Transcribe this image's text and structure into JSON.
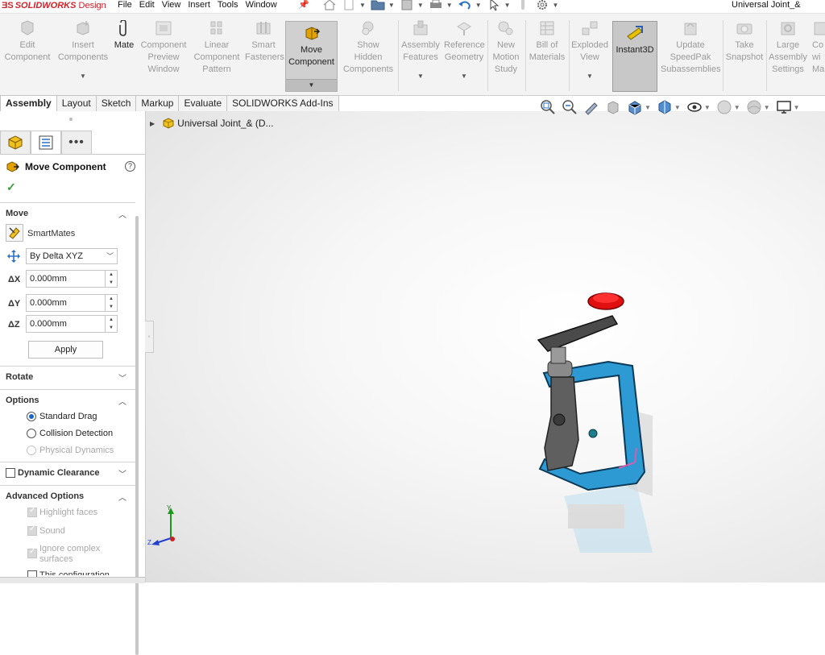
{
  "titlebar": {
    "logo_brand": "SOLIDWORKS",
    "logo_product": "Design",
    "menus": [
      "File",
      "Edit",
      "View",
      "Insert",
      "Tools",
      "Window"
    ],
    "document_title": "Universal Joint_&"
  },
  "command_manager": {
    "edit_component": "Edit\nComponent",
    "insert_components": "Insert\nComponents",
    "mate": "Mate",
    "component_preview": "Component\nPreview\nWindow",
    "linear_pattern": "Linear\nComponent\nPattern",
    "smart_fasteners": "Smart\nFasteners",
    "move_component": "Move\nComponent",
    "show_hidden": "Show\nHidden\nComponents",
    "assembly_features": "Assembly\nFeatures",
    "reference_geometry": "Reference\nGeometry",
    "new_motion_study": "New\nMotion\nStudy",
    "bill_of_materials": "Bill of\nMaterials",
    "exploded_view": "Exploded\nView",
    "instant3d": "Instant3D",
    "update_speedpak": "Update\nSpeedPak\nSubassemblies",
    "take_snapshot": "Take\nSnapshot",
    "large_assembly": "Large\nAssembly\nSettings",
    "cut_off": "Co\nwi\nMa"
  },
  "tabs": [
    "Assembly",
    "Layout",
    "Sketch",
    "Markup",
    "Evaluate",
    "SOLIDWORKS Add-Ins"
  ],
  "property_manager": {
    "title": "Move Component",
    "move_section": "Move",
    "smartmates": "SmartMates",
    "move_mode": "By Delta XYZ",
    "dx_label": "ΔX",
    "dy_label": "ΔY",
    "dz_label": "ΔZ",
    "dx": "0.000mm",
    "dy": "0.000mm",
    "dz": "0.000mm",
    "apply": "Apply",
    "rotate_section": "Rotate",
    "options_section": "Options",
    "standard_drag": "Standard Drag",
    "collision_detection": "Collision Detection",
    "physical_dynamics": "Physical Dynamics",
    "dynamic_clearance": "Dynamic Clearance",
    "advanced_section": "Advanced Options",
    "highlight_faces": "Highlight faces",
    "sound": "Sound",
    "ignore_complex": "Ignore complex\nsurfaces",
    "this_config": "This configuration"
  },
  "tree": {
    "root_item": "Universal Joint_& (D..."
  },
  "triad": {
    "x": "X",
    "y": "Y",
    "z": "Z"
  },
  "colors": {
    "brand_red": "#d2232a",
    "bracket_blue": "#2d9ad4",
    "knob_red": "#e01010",
    "selected_button": "#d0d0d0"
  }
}
